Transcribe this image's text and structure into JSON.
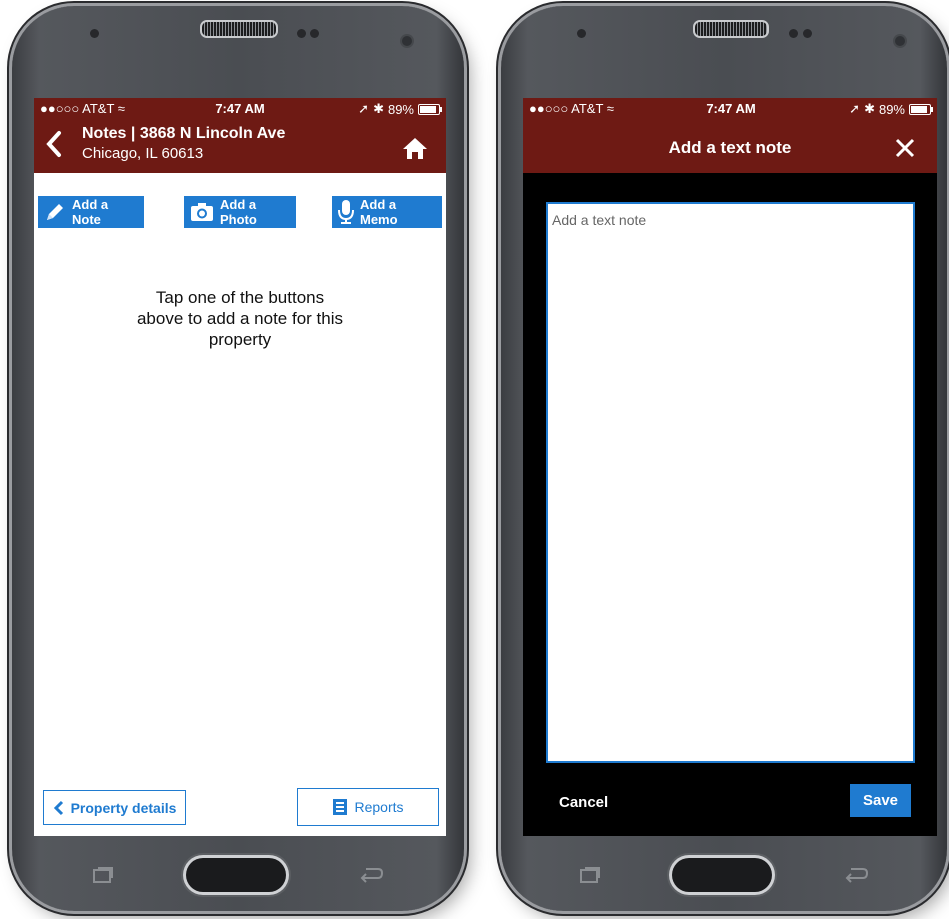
{
  "left_phone": {
    "status": {
      "carrier": "●●○○○ AT&T ≈",
      "time": "7:47 AM",
      "battery": "89%",
      "battery_level": 0.89
    },
    "header": {
      "title": "Notes | 3868 N Lincoln Ave",
      "subtitle": "Chicago, IL 60613",
      "back_icon": "chevron-left-icon",
      "home_icon": "home-icon"
    },
    "actions": {
      "add_note": "Add a Note",
      "add_photo": "Add a Photo",
      "add_memo": "Add a Memo"
    },
    "hint_lines": [
      "Tap one of the buttons",
      "above to add a note for this",
      "property"
    ],
    "footer": {
      "property_details": "Property details",
      "reports": "Reports"
    }
  },
  "right_phone": {
    "status": {
      "carrier": "●●○○○ AT&T ≈",
      "time": "7:47 AM",
      "battery": "89%",
      "battery_level": 0.89
    },
    "header": {
      "title": "Add a text note",
      "close_icon": "close-icon"
    },
    "textarea": {
      "placeholder": "Add a text note"
    },
    "footer": {
      "cancel": "Cancel",
      "save": "Save"
    }
  },
  "colors": {
    "header": "#6e1a14",
    "accent": "#1f7bd0",
    "screen_dark": "#000000"
  }
}
